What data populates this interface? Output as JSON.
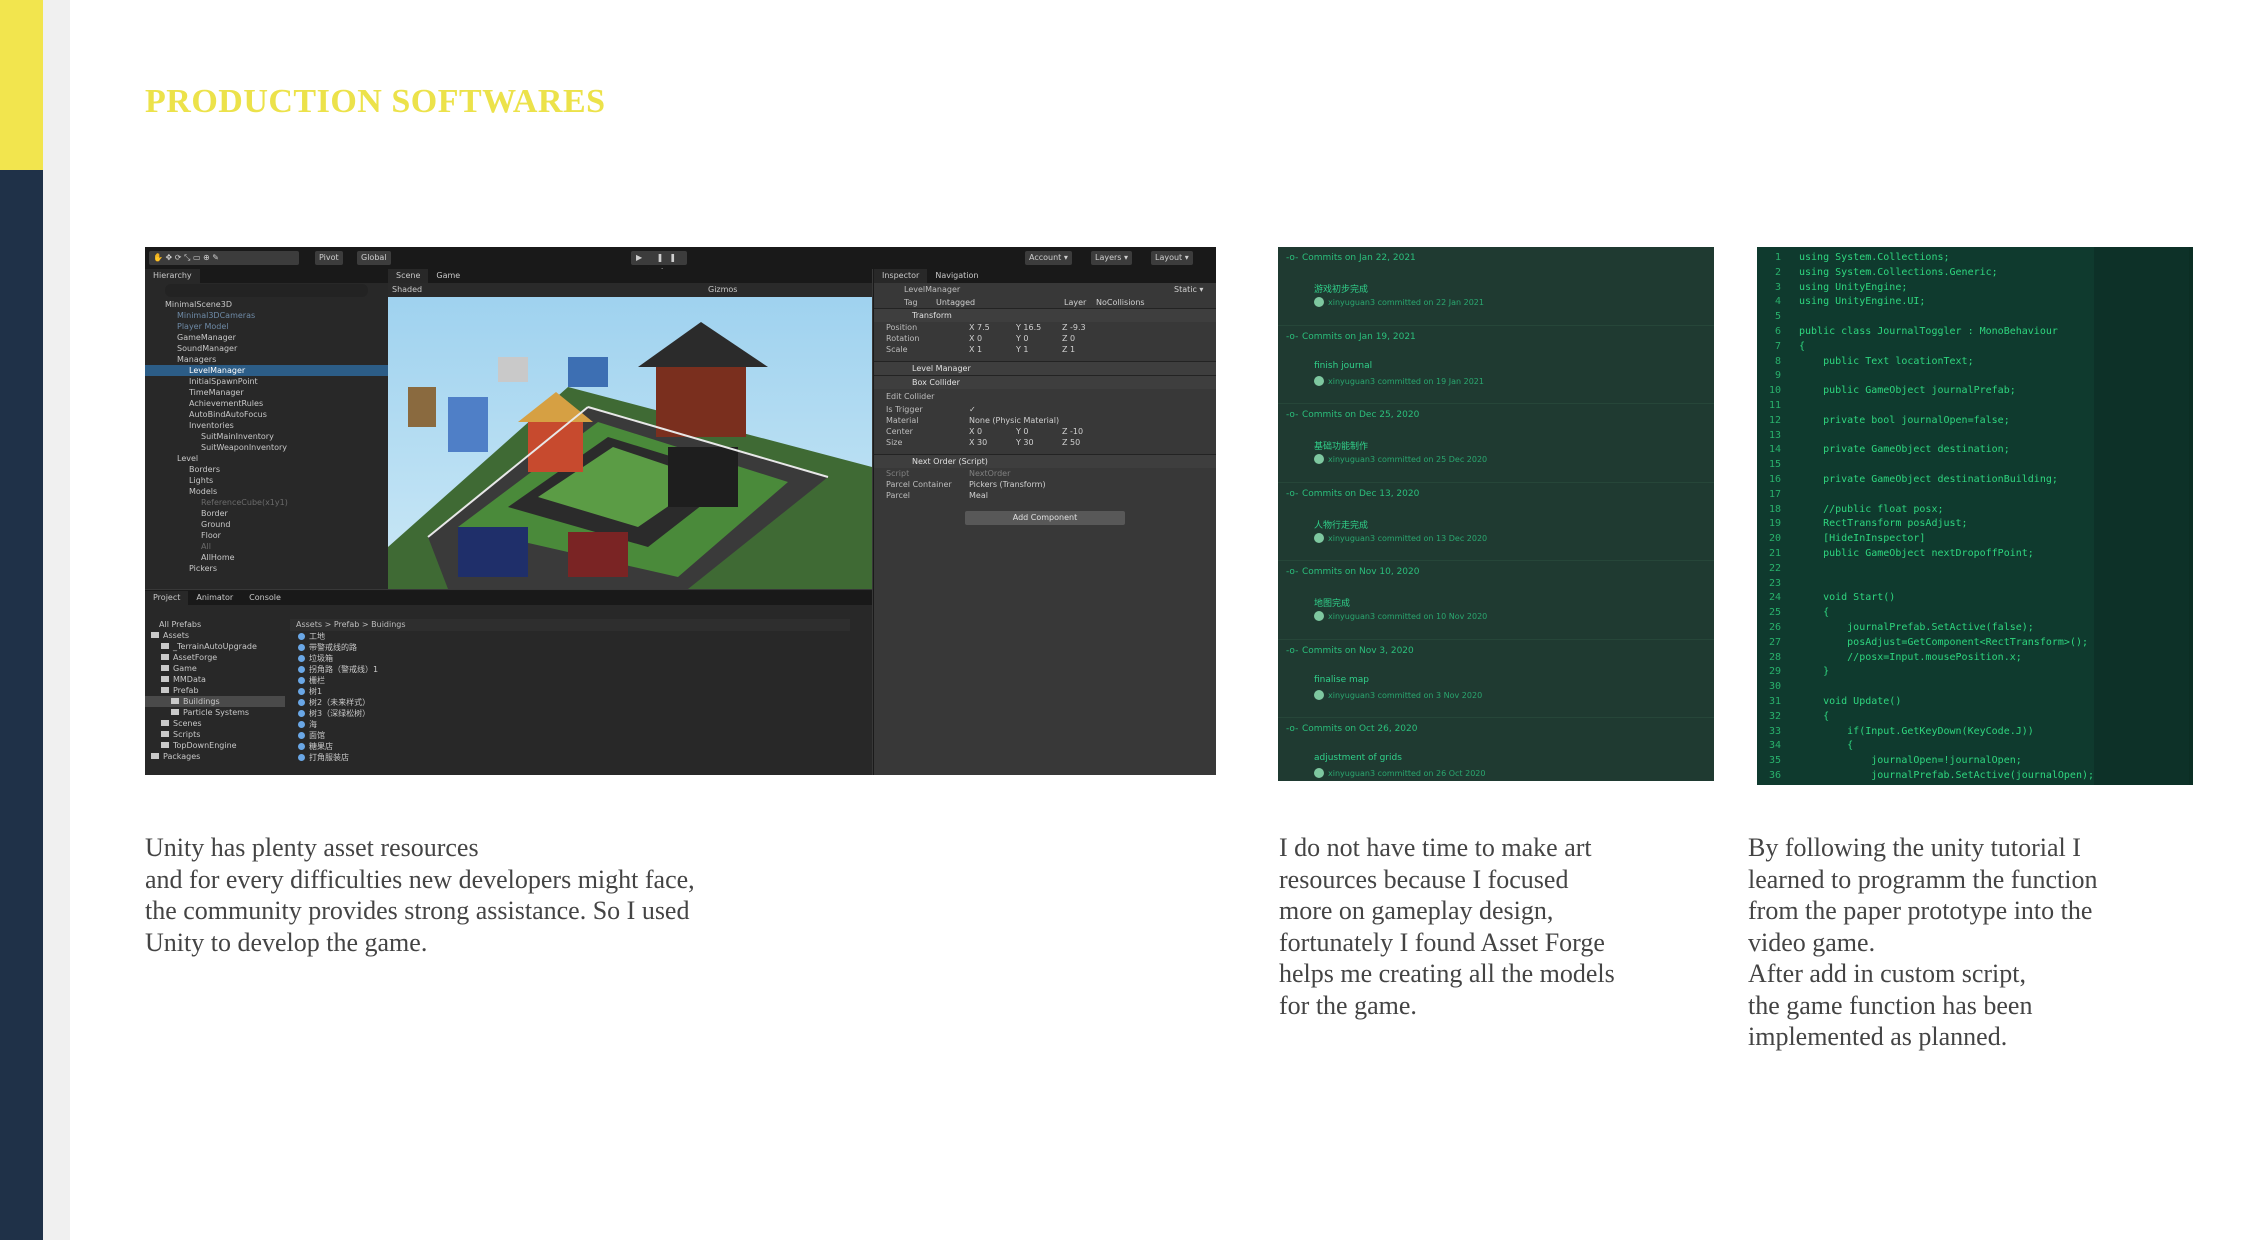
{
  "page": {
    "title": "PRODUCTION SOFTWARES",
    "colors": {
      "sidebar": "#1f3148",
      "accent_yellow": "#f2e54e",
      "title": "#ece24a",
      "text": "#444444"
    }
  },
  "texts": {
    "unity": " Unity has plenty asset resources\nand for every difficulties new developers might face,\nthe community provides strong assistance. So I used\nUnity to develop the game.",
    "assetforge": "I do not have time to make art\nresources because I focused\nmore on gameplay design,\nfortunately I found Asset Forge\nhelps me creating all the models\nfor the game.",
    "tutorial": "By following the unity tutorial I\nlearned to programm the function\nfrom the paper prototype into the\nvideo game.\nAfter add in custom script,\nthe game function has been\nimplemented as planned."
  },
  "unity": {
    "toolbar": {
      "pivot": "Pivot",
      "global": "Global",
      "play": "▶ ❚❚ ▶|",
      "account": "Account ▾",
      "layers": "Layers ▾",
      "layout": "Layout ▾"
    },
    "hierarchy": {
      "tab": "Hierarchy",
      "items": [
        "MinimalScene3D",
        "Minimal3DCameras",
        "Player Model",
        "GameManager",
        "SoundManager",
        "Managers",
        "LevelManager",
        "InitialSpawnPoint",
        "TimeManager",
        "AchievementRules",
        "AutoBindAutoFocus",
        "Inventories",
        "SuitMainInventory",
        "SuitWeaponInventory",
        "Level",
        "Borders",
        "Lights",
        "Models",
        "ReferenceCube(x1y1)",
        "Border",
        "Ground",
        "Floor",
        "All",
        "AllHome",
        "Pickers"
      ]
    },
    "scene": {
      "tab_scene": "Scene",
      "tab_game": "Game",
      "shading": "Shaded",
      "gizmos": "Gizmos"
    },
    "inspector": {
      "tab": "Inspector",
      "tab2": "Navigation",
      "object": "LevelManager",
      "static": "Static ▾",
      "tag": "Untagged",
      "layer": "NoCollisions",
      "transform": "Transform",
      "position": [
        "X 7.5",
        "Y 16.5",
        "Z -9.3"
      ],
      "rotation": [
        "X 0",
        "Y 0",
        "Z 0"
      ],
      "scale": [
        "X 1",
        "Y 1",
        "Z 1"
      ],
      "comp_level_manager": "Level Manager",
      "comp_box_collider": "Box Collider",
      "edit_collider": "Edit Collider",
      "is_trigger": "Is Trigger",
      "material": "Material",
      "material_val": "None (Physic Material)",
      "center": "Center",
      "center_val": [
        "X 0",
        "Y 0",
        "Z -10"
      ],
      "size": "Size",
      "size_val": [
        "X 30",
        "Y 30",
        "Z 50"
      ],
      "comp_next_order": "Next Order (Script)",
      "script": "Script",
      "script_val": "NextOrder",
      "parcel_container": "Parcel Container",
      "parcel_container_val": "Pickers (Transform)",
      "parcel": "Parcel",
      "parcel_val": "Meal",
      "add_component": "Add Component",
      "labels": {
        "position": "Position",
        "rotation": "Rotation",
        "scale": "Scale",
        "tag": "Tag",
        "layer": "Layer"
      }
    },
    "project": {
      "tabs": [
        "Project",
        "Animator",
        "Console"
      ],
      "all_prefabs": "All Prefabs",
      "tree": [
        "Assets",
        "_TerrainAutoUpgrade",
        "AssetForge",
        "Game",
        "MMData",
        "Prefab",
        "Buildings",
        "Particle Systems",
        "Scenes",
        "Scripts",
        "TopDownEngine",
        "Packages"
      ],
      "breadcrumb": "Assets > Prefab > Buidings",
      "files": [
        "工地",
        "带警戒线的路",
        "垃圾箱",
        "拐角路（警戒线）1",
        "栅栏",
        "树1",
        "树2（未来样式）",
        "树3（深绿松树）",
        "海",
        "面馆",
        "糖果店",
        "打角服装店"
      ]
    }
  },
  "commits": [
    {
      "date": "Commits on Jan 22, 2021",
      "message": "游戏初步完成",
      "by": "xinyuguan3 committed on 22 Jan 2021"
    },
    {
      "date": "Commits on Jan 19, 2021",
      "message": "finish journal",
      "by": "xinyuguan3 committed on 19 Jan 2021"
    },
    {
      "date": "Commits on Dec 25, 2020",
      "message": "基础功能制作",
      "by": "xinyuguan3 committed on 25 Dec 2020"
    },
    {
      "date": "Commits on Dec 13, 2020",
      "message": "人物行走完成",
      "by": "xinyuguan3 committed on 13 Dec 2020"
    },
    {
      "date": "Commits on Nov 10, 2020",
      "message": "地图完成",
      "by": "xinyuguan3 committed on 10 Nov 2020"
    },
    {
      "date": "Commits on Nov 3, 2020",
      "message": "finalise map",
      "by": "xinyuguan3 committed on 3 Nov 2020"
    },
    {
      "date": "Commits on Oct 26, 2020",
      "message": "adjustment of grids",
      "by": "xinyuguan3 committed on 26 Oct 2020"
    }
  ],
  "code": [
    {
      "n": "1",
      "t": "using System.Collections;"
    },
    {
      "n": "2",
      "t": "using System.Collections.Generic;"
    },
    {
      "n": "3",
      "t": "using UnityEngine;"
    },
    {
      "n": "4",
      "t": "using UnityEngine.UI;"
    },
    {
      "n": "5",
      "t": ""
    },
    {
      "n": "6",
      "t": "public class JournalToggler : MonoBehaviour"
    },
    {
      "n": "7",
      "t": "{"
    },
    {
      "n": "8",
      "t": "    public Text locationText;"
    },
    {
      "n": "9",
      "t": ""
    },
    {
      "n": "10",
      "t": "    public GameObject journalPrefab;"
    },
    {
      "n": "11",
      "t": ""
    },
    {
      "n": "12",
      "t": "    private bool journalOpen=false;"
    },
    {
      "n": "13",
      "t": ""
    },
    {
      "n": "14",
      "t": "    private GameObject destination;"
    },
    {
      "n": "15",
      "t": ""
    },
    {
      "n": "16",
      "t": "    private GameObject destinationBuilding;"
    },
    {
      "n": "17",
      "t": ""
    },
    {
      "n": "18",
      "t": "    //public float posx;"
    },
    {
      "n": "19",
      "t": "    RectTransform posAdjust;"
    },
    {
      "n": "20",
      "t": "    [HideInInspector]"
    },
    {
      "n": "21",
      "t": "    public GameObject nextDropoffPoint;"
    },
    {
      "n": "22",
      "t": ""
    },
    {
      "n": "23",
      "t": ""
    },
    {
      "n": "24",
      "t": "    void Start()"
    },
    {
      "n": "25",
      "t": "    {"
    },
    {
      "n": "26",
      "t": "        journalPrefab.SetActive(false);"
    },
    {
      "n": "27",
      "t": "        posAdjust=GetComponent<RectTransform>();"
    },
    {
      "n": "28",
      "t": "        //posx=Input.mousePosition.x;"
    },
    {
      "n": "29",
      "t": "    }"
    },
    {
      "n": "30",
      "t": ""
    },
    {
      "n": "31",
      "t": "    void Update()"
    },
    {
      "n": "32",
      "t": "    {"
    },
    {
      "n": "33",
      "t": "        if(Input.GetKeyDown(KeyCode.J))"
    },
    {
      "n": "34",
      "t": "        {"
    },
    {
      "n": "35",
      "t": "            journalOpen=!journalOpen;"
    },
    {
      "n": "36",
      "t": "            journalPrefab.SetActive(journalOpen);"
    }
  ]
}
